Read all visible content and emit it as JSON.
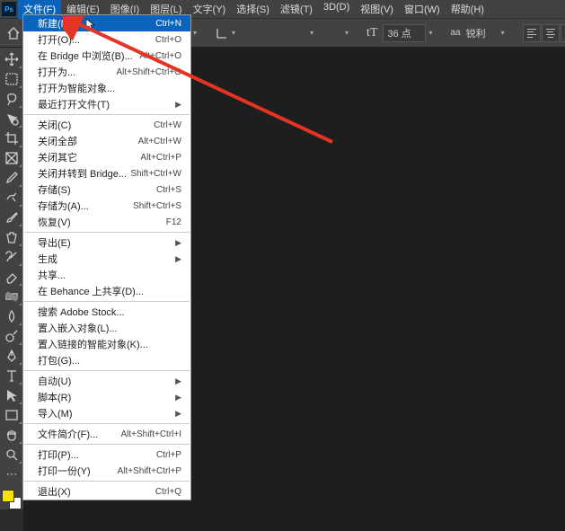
{
  "menubar": {
    "items": [
      {
        "label": "文件(F)",
        "active": true
      },
      {
        "label": "编辑(E)"
      },
      {
        "label": "图像(I)"
      },
      {
        "label": "图层(L)"
      },
      {
        "label": "文字(Y)"
      },
      {
        "label": "选择(S)"
      },
      {
        "label": "滤镜(T)"
      },
      {
        "label": "3D(D)"
      },
      {
        "label": "视图(V)"
      },
      {
        "label": "窗口(W)"
      },
      {
        "label": "帮助(H)"
      }
    ]
  },
  "optionsbar": {
    "font_size_value": "36 点",
    "aa_icon": "aa",
    "aa_label": "锐利"
  },
  "file_menu": {
    "groups": [
      [
        {
          "label": "新建(N)",
          "shortcut": "Ctrl+N",
          "highlight": true
        },
        {
          "label": "打开(O)...",
          "shortcut": "Ctrl+O"
        },
        {
          "label": "在 Bridge 中浏览(B)...",
          "shortcut": "Alt+Ctrl+O"
        },
        {
          "label": "打开为...",
          "shortcut": "Alt+Shift+Ctrl+O"
        },
        {
          "label": "打开为智能对象..."
        },
        {
          "label": "最近打开文件(T)",
          "submenu": true
        }
      ],
      [
        {
          "label": "关闭(C)",
          "shortcut": "Ctrl+W"
        },
        {
          "label": "关闭全部",
          "shortcut": "Alt+Ctrl+W"
        },
        {
          "label": "关闭其它",
          "shortcut": "Alt+Ctrl+P"
        },
        {
          "label": "关闭并转到 Bridge...",
          "shortcut": "Shift+Ctrl+W"
        },
        {
          "label": "存储(S)",
          "shortcut": "Ctrl+S"
        },
        {
          "label": "存储为(A)...",
          "shortcut": "Shift+Ctrl+S"
        },
        {
          "label": "恢复(V)",
          "shortcut": "F12"
        }
      ],
      [
        {
          "label": "导出(E)",
          "submenu": true
        },
        {
          "label": "生成",
          "submenu": true
        },
        {
          "label": "共享..."
        },
        {
          "label": "在 Behance 上共享(D)..."
        }
      ],
      [
        {
          "label": "搜索 Adobe Stock..."
        },
        {
          "label": "置入嵌入对象(L)..."
        },
        {
          "label": "置入链接的智能对象(K)..."
        },
        {
          "label": "打包(G)..."
        }
      ],
      [
        {
          "label": "自动(U)",
          "submenu": true
        },
        {
          "label": "脚本(R)",
          "submenu": true
        },
        {
          "label": "导入(M)",
          "submenu": true
        }
      ],
      [
        {
          "label": "文件简介(F)...",
          "shortcut": "Alt+Shift+Ctrl+I"
        }
      ],
      [
        {
          "label": "打印(P)...",
          "shortcut": "Ctrl+P"
        },
        {
          "label": "打印一份(Y)",
          "shortcut": "Alt+Shift+Ctrl+P"
        }
      ],
      [
        {
          "label": "退出(X)",
          "shortcut": "Ctrl+Q"
        }
      ]
    ]
  },
  "tools": [
    "move",
    "marquee",
    "lasso",
    "quick-select",
    "crop",
    "frame",
    "eyedropper",
    "spot-heal",
    "brush",
    "clone",
    "history-brush",
    "eraser",
    "gradient",
    "blur",
    "dodge",
    "pen",
    "type",
    "path-select",
    "rectangle",
    "hand",
    "zoom"
  ]
}
